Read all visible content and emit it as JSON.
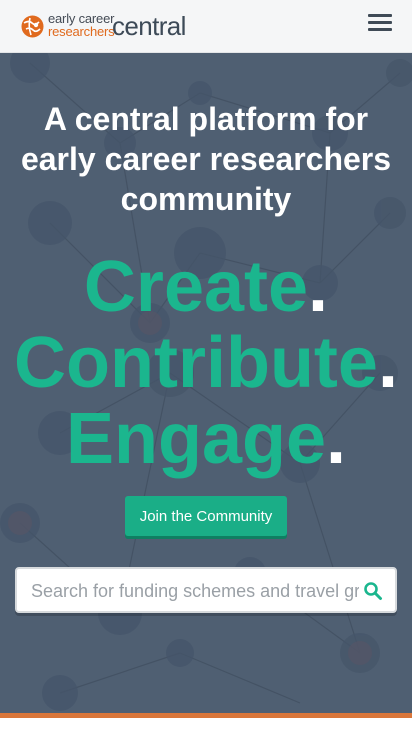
{
  "header": {
    "logo_line1": "early career",
    "logo_line2": "researchers",
    "logo_brand": "central",
    "menu_icon": "hamburger-menu-icon"
  },
  "hero": {
    "headline": "A central platform for early career researchers community",
    "motto": [
      {
        "word": "Create",
        "dot": "."
      },
      {
        "word": "Contribute",
        "dot": "."
      },
      {
        "word": "Engage",
        "dot": "."
      }
    ],
    "join_button": "Join the Community",
    "search": {
      "placeholder": "Search for funding schemes and travel grants",
      "value": "",
      "icon": "search-icon"
    }
  },
  "colors": {
    "accent": "#1bb68e",
    "hero_bg": "#4f5f72",
    "brand_orange": "#e06a1e",
    "strip": "#d9763a"
  }
}
